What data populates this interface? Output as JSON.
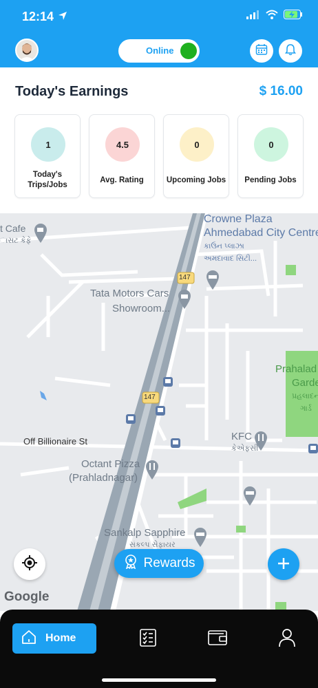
{
  "status_bar": {
    "time": "12:14"
  },
  "header": {
    "online_label": "Online"
  },
  "earnings": {
    "title": "Today's Earnings",
    "amount": "$ 16.00",
    "stats": [
      {
        "value": "1",
        "label_line1": "Today's",
        "label_line2": "Trips/Jobs",
        "color": "#c9ecec"
      },
      {
        "value": "4.5",
        "label_line1": "Avg. Rating",
        "label_line2": "",
        "color": "#fbd5d5"
      },
      {
        "value": "0",
        "label_line1": "Upcoming Jobs",
        "label_line2": "",
        "color": "#fdf0c8"
      },
      {
        "value": "0",
        "label_line1": "Pending Jobs",
        "label_line2": "",
        "color": "#cdf5df"
      }
    ]
  },
  "map": {
    "labels": {
      "cafe": "t Cafe",
      "cafe_guj": "ાસટ કેફે",
      "crowne": "Crowne Plaza",
      "crowne2": "Ahmedabad City Centre",
      "crowne_guj": "કાઉન પ્લાઝા",
      "crowne_guj2": "અમદાવાદ સિટી...",
      "hwy1": "147",
      "hwy2": "147",
      "tata": "Tata Motors Cars",
      "tata2": "Showroom...",
      "prahlad": "Prahalad",
      "prahlad2": "Garde",
      "prahlad_guj": "પ્રહલાદન",
      "prahlad_guj2": "ગાર્ડ",
      "street": "Off Billionaire St",
      "kfc": "KFC",
      "kfc_guj": "કેએફસી",
      "octant": "Octant Pizza",
      "octant2": "(Prahladnagar)",
      "sankalp": "Sankalp Sapphire",
      "sankalp_guj": "સંકલ્પ સેફાયર"
    },
    "google": "Google"
  },
  "rewards_label": "Rewards",
  "nav": {
    "home_label": "Home"
  },
  "colors": {
    "accent": "#1da1f2",
    "online": "#1fb01f",
    "dark": "#0b0b0b"
  }
}
